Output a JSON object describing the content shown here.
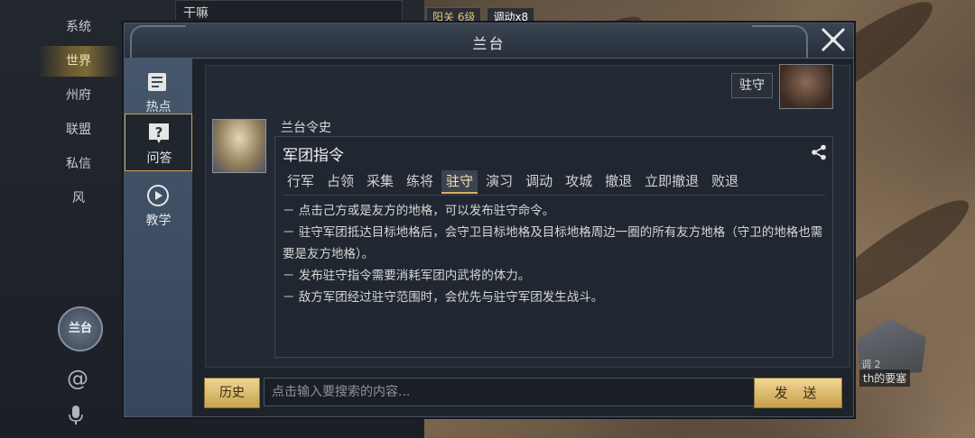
{
  "background": {
    "chat_strip_text": "干嘛",
    "map_tags": [
      "阳关 6级",
      "调动x8"
    ],
    "city_label": "th的要塞",
    "city_sub": "调  2"
  },
  "sidebar": {
    "items": [
      {
        "label": "系统",
        "active": false
      },
      {
        "label": "世界",
        "active": true
      },
      {
        "label": "州府",
        "active": false
      },
      {
        "label": "联盟",
        "active": false
      },
      {
        "label": "私信",
        "active": false
      },
      {
        "label": "风",
        "active": false
      }
    ],
    "badge_label": "兰台"
  },
  "modal": {
    "title": "兰台",
    "nav": [
      {
        "label": "热点",
        "icon": "news-icon",
        "active": false
      },
      {
        "label": "问答",
        "icon": "question-icon",
        "active": true
      },
      {
        "label": "教学",
        "icon": "play-icon",
        "active": false
      }
    ],
    "user_message": {
      "text": "驻守"
    },
    "npc": {
      "name": "兰台令史"
    },
    "answer": {
      "title": "军团指令",
      "tabs": [
        {
          "label": "行军",
          "active": false
        },
        {
          "label": "占领",
          "active": false
        },
        {
          "label": "采集",
          "active": false
        },
        {
          "label": "练将",
          "active": false
        },
        {
          "label": "驻守",
          "active": true
        },
        {
          "label": "演习",
          "active": false
        },
        {
          "label": "调动",
          "active": false
        },
        {
          "label": "攻城",
          "active": false
        },
        {
          "label": "撤退",
          "active": false
        },
        {
          "label": "立即撤退",
          "active": false
        },
        {
          "label": "败退",
          "active": false
        }
      ],
      "lines": [
        "－ 点击己方或是友方的地格，可以发布驻守命令。",
        "－ 驻守军团抵达目标地格后，会守卫目标地格及目标地格周边一圈的所有友方地格（守卫的地格也需要是友方地格）。",
        "－ 发布驻守指令需要消耗军团内武将的体力。",
        "－ 敌方军团经过驻守范围时，会优先与驻守军团发生战斗。"
      ]
    },
    "input": {
      "history_label": "历史",
      "placeholder": "点击输入要搜索的内容...",
      "send_label": "发 送"
    }
  },
  "colors": {
    "accent_gold": "#d7b55e",
    "panel_bg": "#1d232b",
    "nav_bg": "#46576c"
  }
}
